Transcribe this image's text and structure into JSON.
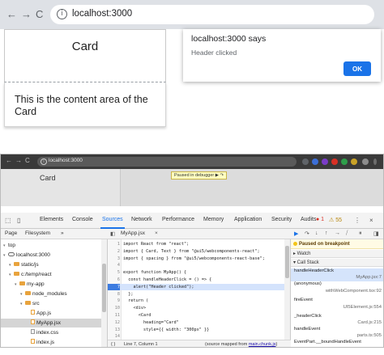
{
  "top": {
    "nav": {
      "back": "←",
      "forward": "→",
      "reload": "C"
    },
    "url": "localhost:3000",
    "card": {
      "heading": "Card",
      "content": "This is the content area of the Card"
    },
    "dialog": {
      "title": "localhost:3000 says",
      "message": "Header clicked",
      "ok_label": "OK"
    }
  },
  "bottom": {
    "url": "localhost:3000",
    "paused_tooltip": "Paused in debugger  ▶  ↷",
    "card_heading": "Card",
    "devtools_tabs": [
      "Elements",
      "Console",
      "Sources",
      "Network",
      "Performance",
      "Memory",
      "Application",
      "Security",
      "Audits"
    ],
    "active_tab": "Sources",
    "error_count": "● 1",
    "warning_count": "⚠ 55",
    "navigator_tabs": {
      "page": "Page",
      "filesystem": "Filesystem",
      "more": "»"
    },
    "tree": [
      {
        "label": "top",
        "indent": 0,
        "kind": "none"
      },
      {
        "label": "localhost:3000",
        "indent": 0,
        "kind": "cloud"
      },
      {
        "label": "static/js",
        "indent": 1,
        "kind": "folder"
      },
      {
        "label": "c:/temp/react",
        "indent": 1,
        "kind": "folder"
      },
      {
        "label": "my-app",
        "indent": 2,
        "kind": "folder"
      },
      {
        "label": "node_modules",
        "indent": 3,
        "kind": "folder"
      },
      {
        "label": "src",
        "indent": 3,
        "kind": "folder"
      },
      {
        "label": "App.js",
        "indent": 4,
        "kind": "file"
      },
      {
        "label": "MyApp.jsx",
        "indent": 4,
        "kind": "file",
        "selected": true
      },
      {
        "label": "index.css",
        "indent": 4,
        "kind": "dfile"
      },
      {
        "label": "index.js",
        "indent": 4,
        "kind": "file"
      }
    ],
    "editor_tab": {
      "name": "MyApp.jsx",
      "close": "×"
    },
    "code_lines": [
      {
        "n": "1",
        "t": "import React from \"react\";"
      },
      {
        "n": "2",
        "t": "import { Card, Text } from \"@ui5/webcomponents-react\";"
      },
      {
        "n": "3",
        "t": "import { spacing } from \"@ui5/webcomponents-react-base\";"
      },
      {
        "n": "4",
        "t": ""
      },
      {
        "n": "5",
        "t": "export function MyApp() {"
      },
      {
        "n": "6",
        "t": "  const handleHeaderClick = () => {"
      },
      {
        "n": "7",
        "t": "    alert(\"Header clicked\");",
        "hl": true
      },
      {
        "n": "8",
        "t": "  };"
      },
      {
        "n": "9",
        "t": "  return ("
      },
      {
        "n": "10",
        "t": "    <div>"
      },
      {
        "n": "11",
        "t": "      <Card"
      },
      {
        "n": "12",
        "t": "        heading=\"Card\""
      },
      {
        "n": "13",
        "t": "        style={{ width: \"300px\" }}"
      },
      {
        "n": "14",
        "t": ""
      }
    ],
    "status": {
      "position": "Line 7, Column 1",
      "source_prefix": "(source mapped from ",
      "source_file": "main.chunk.js",
      "source_suffix": ")"
    },
    "debugger": {
      "paused": "Paused on breakpoint",
      "watch": "▸ Watch",
      "callstack": "▾ Call Stack",
      "frames": [
        {
          "name": "handleHeaderClick",
          "loc": "MyApp.jsx:7",
          "sel": true
        },
        {
          "name": "(anonymous)",
          "loc": "withWebComponent.tsx:92"
        },
        {
          "name": "fireEvent",
          "loc": "UI5Element.js:554"
        },
        {
          "name": "_headerClick",
          "loc": "Card.js:215"
        },
        {
          "name": "handleEvent",
          "loc": "parts.ts:505"
        },
        {
          "name": "EventPart.__boundHandleEvent",
          "loc": ""
        }
      ]
    },
    "colors": {
      "accent": "#1a73e8",
      "highlight": "#d4e3fc",
      "folder": "#e8a33d"
    }
  }
}
